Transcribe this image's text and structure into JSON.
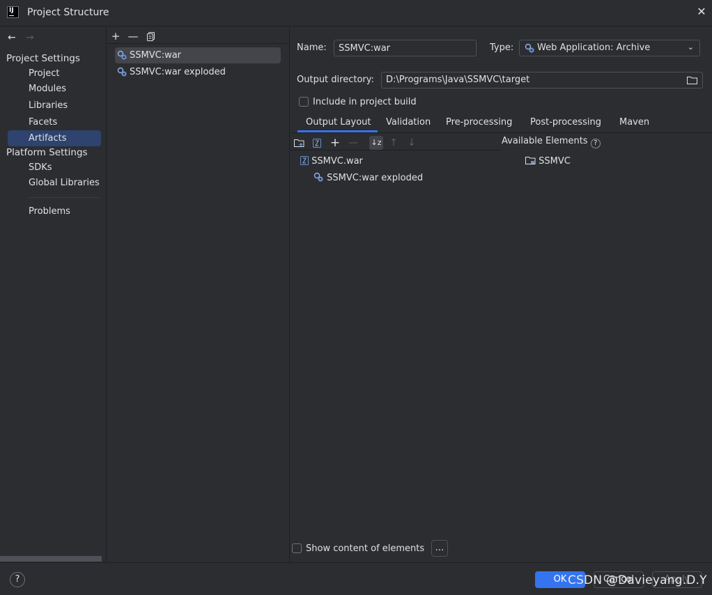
{
  "window": {
    "title": "Project Structure"
  },
  "nav": {
    "project_settings": "Project Settings",
    "project_items": [
      "Project",
      "Modules",
      "Libraries",
      "Facets",
      "Artifacts"
    ],
    "platform_settings": "Platform Settings",
    "platform_items": [
      "SDKs",
      "Global Libraries"
    ],
    "problems": "Problems",
    "selected": "Artifacts"
  },
  "artifacts": {
    "items": [
      "SSMVC:war",
      "SSMVC:war exploded"
    ],
    "selected": "SSMVC:war"
  },
  "details": {
    "name_label": "Name:",
    "name_value": "SSMVC:war",
    "type_label": "Type:",
    "type_value": "Web Application: Archive",
    "output_dir_label": "Output directory:",
    "output_dir_value": "D:\\Programs\\Java\\SSMVC\\target",
    "include_build_label": "Include in project build",
    "include_build_checked": false,
    "tabs": [
      "Output Layout",
      "Validation",
      "Pre-processing",
      "Post-processing",
      "Maven"
    ],
    "active_tab": "Output Layout",
    "available_elements_label": "Available Elements",
    "layout_tree": [
      "SSMVC.war",
      "SSMVC:war exploded"
    ],
    "available_tree": [
      "SSMVC"
    ],
    "show_content_label": "Show content of elements",
    "show_content_checked": false,
    "more_button": "..."
  },
  "footer": {
    "help": "?",
    "ok": "OK",
    "cancel": "Cancel",
    "apply": "Apply"
  },
  "watermark": "CSDN @Davieyang.D.Y",
  "colors": {
    "accent": "#3574f0",
    "selection": "#2e436e",
    "background": "#2b2d30"
  }
}
